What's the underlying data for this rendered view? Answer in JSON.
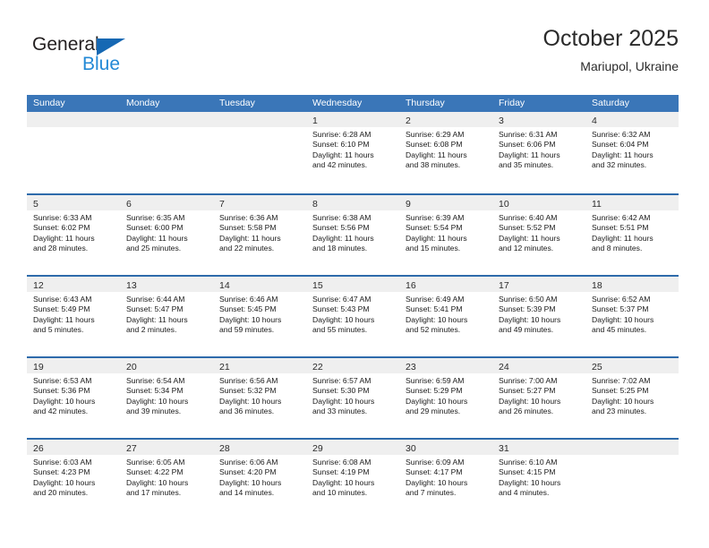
{
  "brand": {
    "name_top": "General",
    "name_bottom": "Blue",
    "triangle_color": "#1668b3",
    "blue_color": "#2389d6"
  },
  "header": {
    "title": "October 2025",
    "subtitle": "Mariupol, Ukraine"
  },
  "theme": {
    "header_bar": "#3a76b8",
    "row_divider": "#2e6bab",
    "day_band": "#efefef",
    "text": "#1a1a1a"
  },
  "weekdays": [
    "Sunday",
    "Monday",
    "Tuesday",
    "Wednesday",
    "Thursday",
    "Friday",
    "Saturday"
  ],
  "weeks": [
    [
      {
        "empty": true
      },
      {
        "empty": true
      },
      {
        "empty": true
      },
      {
        "day": "1",
        "sunrise": "Sunrise: 6:28 AM",
        "sunset": "Sunset: 6:10 PM",
        "daylight1": "Daylight: 11 hours",
        "daylight2": "and 42 minutes."
      },
      {
        "day": "2",
        "sunrise": "Sunrise: 6:29 AM",
        "sunset": "Sunset: 6:08 PM",
        "daylight1": "Daylight: 11 hours",
        "daylight2": "and 38 minutes."
      },
      {
        "day": "3",
        "sunrise": "Sunrise: 6:31 AM",
        "sunset": "Sunset: 6:06 PM",
        "daylight1": "Daylight: 11 hours",
        "daylight2": "and 35 minutes."
      },
      {
        "day": "4",
        "sunrise": "Sunrise: 6:32 AM",
        "sunset": "Sunset: 6:04 PM",
        "daylight1": "Daylight: 11 hours",
        "daylight2": "and 32 minutes."
      }
    ],
    [
      {
        "day": "5",
        "sunrise": "Sunrise: 6:33 AM",
        "sunset": "Sunset: 6:02 PM",
        "daylight1": "Daylight: 11 hours",
        "daylight2": "and 28 minutes."
      },
      {
        "day": "6",
        "sunrise": "Sunrise: 6:35 AM",
        "sunset": "Sunset: 6:00 PM",
        "daylight1": "Daylight: 11 hours",
        "daylight2": "and 25 minutes."
      },
      {
        "day": "7",
        "sunrise": "Sunrise: 6:36 AM",
        "sunset": "Sunset: 5:58 PM",
        "daylight1": "Daylight: 11 hours",
        "daylight2": "and 22 minutes."
      },
      {
        "day": "8",
        "sunrise": "Sunrise: 6:38 AM",
        "sunset": "Sunset: 5:56 PM",
        "daylight1": "Daylight: 11 hours",
        "daylight2": "and 18 minutes."
      },
      {
        "day": "9",
        "sunrise": "Sunrise: 6:39 AM",
        "sunset": "Sunset: 5:54 PM",
        "daylight1": "Daylight: 11 hours",
        "daylight2": "and 15 minutes."
      },
      {
        "day": "10",
        "sunrise": "Sunrise: 6:40 AM",
        "sunset": "Sunset: 5:52 PM",
        "daylight1": "Daylight: 11 hours",
        "daylight2": "and 12 minutes."
      },
      {
        "day": "11",
        "sunrise": "Sunrise: 6:42 AM",
        "sunset": "Sunset: 5:51 PM",
        "daylight1": "Daylight: 11 hours",
        "daylight2": "and 8 minutes."
      }
    ],
    [
      {
        "day": "12",
        "sunrise": "Sunrise: 6:43 AM",
        "sunset": "Sunset: 5:49 PM",
        "daylight1": "Daylight: 11 hours",
        "daylight2": "and 5 minutes."
      },
      {
        "day": "13",
        "sunrise": "Sunrise: 6:44 AM",
        "sunset": "Sunset: 5:47 PM",
        "daylight1": "Daylight: 11 hours",
        "daylight2": "and 2 minutes."
      },
      {
        "day": "14",
        "sunrise": "Sunrise: 6:46 AM",
        "sunset": "Sunset: 5:45 PM",
        "daylight1": "Daylight: 10 hours",
        "daylight2": "and 59 minutes."
      },
      {
        "day": "15",
        "sunrise": "Sunrise: 6:47 AM",
        "sunset": "Sunset: 5:43 PM",
        "daylight1": "Daylight: 10 hours",
        "daylight2": "and 55 minutes."
      },
      {
        "day": "16",
        "sunrise": "Sunrise: 6:49 AM",
        "sunset": "Sunset: 5:41 PM",
        "daylight1": "Daylight: 10 hours",
        "daylight2": "and 52 minutes."
      },
      {
        "day": "17",
        "sunrise": "Sunrise: 6:50 AM",
        "sunset": "Sunset: 5:39 PM",
        "daylight1": "Daylight: 10 hours",
        "daylight2": "and 49 minutes."
      },
      {
        "day": "18",
        "sunrise": "Sunrise: 6:52 AM",
        "sunset": "Sunset: 5:37 PM",
        "daylight1": "Daylight: 10 hours",
        "daylight2": "and 45 minutes."
      }
    ],
    [
      {
        "day": "19",
        "sunrise": "Sunrise: 6:53 AM",
        "sunset": "Sunset: 5:36 PM",
        "daylight1": "Daylight: 10 hours",
        "daylight2": "and 42 minutes."
      },
      {
        "day": "20",
        "sunrise": "Sunrise: 6:54 AM",
        "sunset": "Sunset: 5:34 PM",
        "daylight1": "Daylight: 10 hours",
        "daylight2": "and 39 minutes."
      },
      {
        "day": "21",
        "sunrise": "Sunrise: 6:56 AM",
        "sunset": "Sunset: 5:32 PM",
        "daylight1": "Daylight: 10 hours",
        "daylight2": "and 36 minutes."
      },
      {
        "day": "22",
        "sunrise": "Sunrise: 6:57 AM",
        "sunset": "Sunset: 5:30 PM",
        "daylight1": "Daylight: 10 hours",
        "daylight2": "and 33 minutes."
      },
      {
        "day": "23",
        "sunrise": "Sunrise: 6:59 AM",
        "sunset": "Sunset: 5:29 PM",
        "daylight1": "Daylight: 10 hours",
        "daylight2": "and 29 minutes."
      },
      {
        "day": "24",
        "sunrise": "Sunrise: 7:00 AM",
        "sunset": "Sunset: 5:27 PM",
        "daylight1": "Daylight: 10 hours",
        "daylight2": "and 26 minutes."
      },
      {
        "day": "25",
        "sunrise": "Sunrise: 7:02 AM",
        "sunset": "Sunset: 5:25 PM",
        "daylight1": "Daylight: 10 hours",
        "daylight2": "and 23 minutes."
      }
    ],
    [
      {
        "day": "26",
        "sunrise": "Sunrise: 6:03 AM",
        "sunset": "Sunset: 4:23 PM",
        "daylight1": "Daylight: 10 hours",
        "daylight2": "and 20 minutes."
      },
      {
        "day": "27",
        "sunrise": "Sunrise: 6:05 AM",
        "sunset": "Sunset: 4:22 PM",
        "daylight1": "Daylight: 10 hours",
        "daylight2": "and 17 minutes."
      },
      {
        "day": "28",
        "sunrise": "Sunrise: 6:06 AM",
        "sunset": "Sunset: 4:20 PM",
        "daylight1": "Daylight: 10 hours",
        "daylight2": "and 14 minutes."
      },
      {
        "day": "29",
        "sunrise": "Sunrise: 6:08 AM",
        "sunset": "Sunset: 4:19 PM",
        "daylight1": "Daylight: 10 hours",
        "daylight2": "and 10 minutes."
      },
      {
        "day": "30",
        "sunrise": "Sunrise: 6:09 AM",
        "sunset": "Sunset: 4:17 PM",
        "daylight1": "Daylight: 10 hours",
        "daylight2": "and 7 minutes."
      },
      {
        "day": "31",
        "sunrise": "Sunrise: 6:10 AM",
        "sunset": "Sunset: 4:15 PM",
        "daylight1": "Daylight: 10 hours",
        "daylight2": "and 4 minutes."
      },
      {
        "empty": true
      }
    ]
  ]
}
